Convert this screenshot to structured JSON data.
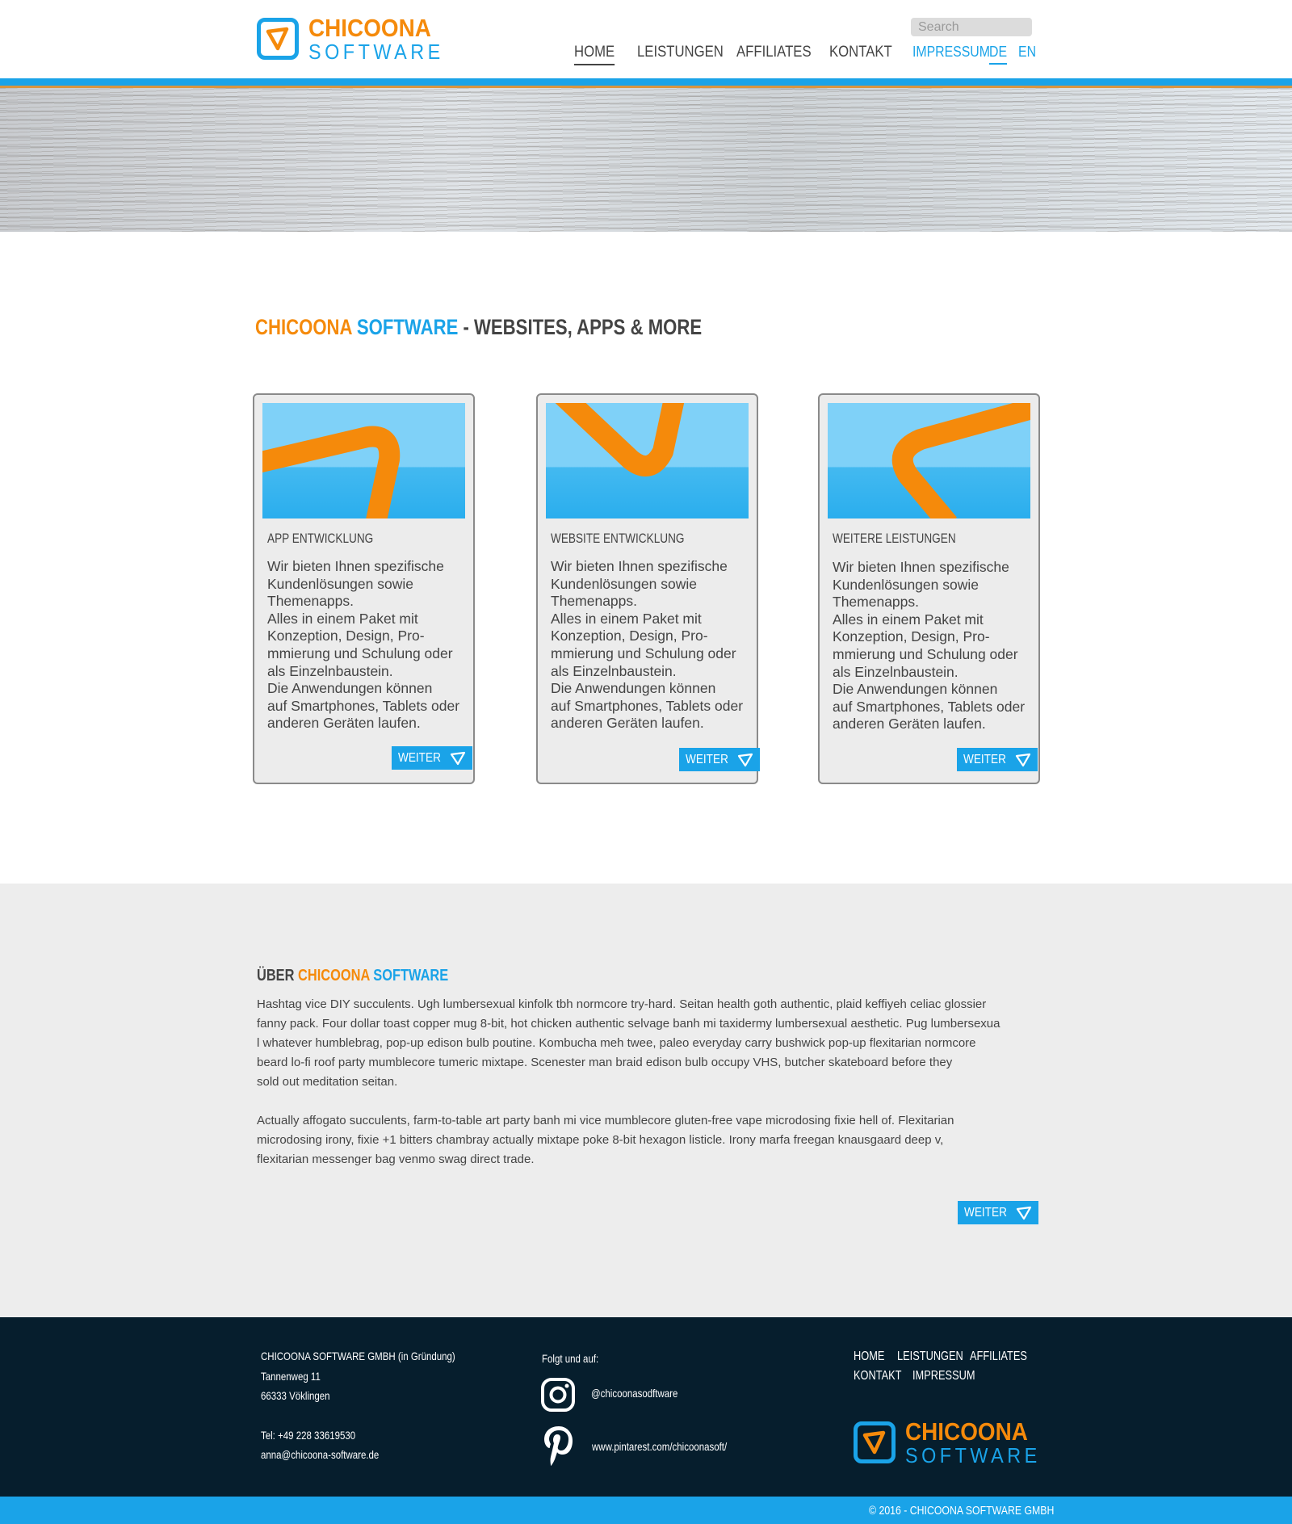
{
  "header": {
    "logo_line1": "CHICOONA",
    "logo_line2": "SOFTWARE",
    "search_placeholder": "Search",
    "nav": [
      "HOME",
      "LEISTUNGEN",
      "AFFILIATES",
      "KONTAKT"
    ],
    "secondary_nav": [
      "IMPRESSUM",
      "DE",
      "EN"
    ],
    "active_nav": "HOME",
    "active_lang": "DE"
  },
  "intro": {
    "title_orange": "CHICOONA",
    "title_blue": "SOFTWARE",
    "title_rest": " - WEBSITES, APPS & MORE"
  },
  "cards": [
    {
      "title": "APP ENTWICKLUNG",
      "lines": [
        "Wir bieten Ihnen spezifische",
        "Kundenlösungen sowie",
        "Themenapps.",
        "Alles in einem Paket mit",
        "Konzeption, Design, Pro-",
        "mmierung und Schulung oder",
        "als Einzelnbaustein.",
        "Die Anwendungen können",
        "auf Smartphones, Tablets oder",
        "anderen Geräten laufen."
      ],
      "button": "WEITER"
    },
    {
      "title": "WEBSITE ENTWICKLUNG",
      "lines": [
        "Wir bieten Ihnen spezifische",
        "Kundenlösungen sowie",
        "Themenapps.",
        "Alles in einem Paket mit",
        "Konzeption, Design, Pro-",
        "mmierung und Schulung oder",
        "als Einzelnbaustein.",
        "Die Anwendungen können",
        "auf Smartphones, Tablets oder",
        "anderen Geräten laufen."
      ],
      "button": "WEITER"
    },
    {
      "title": "WEITERE LEISTUNGEN",
      "lines": [
        "Wir bieten Ihnen spezifische",
        "Kundenlösungen sowie",
        "Themenapps.",
        "Alles in einem Paket mit",
        "Konzeption, Design, Pro-",
        "mmierung und Schulung oder",
        "als Einzelnbaustein.",
        "Die Anwendungen können",
        "auf Smartphones, Tablets oder",
        "anderen Geräten laufen."
      ],
      "button": "WEITER"
    }
  ],
  "about": {
    "title_prefix": "ÜBER ",
    "title_orange": "CHICOONA",
    "title_blue": " SOFTWARE",
    "paragraph1": [
      "Hashtag vice DIY succulents. Ugh lumbersexual kinfolk tbh normcore try-hard. Seitan health goth authentic, plaid keffiyeh celiac glossier",
      " fanny pack. Four dollar toast copper mug 8-bit, hot chicken authentic selvage banh mi taxidermy lumbersexual aesthetic. Pug lumbersexua",
      "l whatever humblebrag, pop-up edison bulb poutine. Kombucha meh twee, paleo everyday carry bushwick pop-up flexitarian normcore",
      " beard lo-fi roof party mumblecore tumeric mixtape. Scenester man braid edison bulb occupy VHS, butcher skateboard before they",
      " sold out meditation seitan."
    ],
    "paragraph2": [
      "Actually affogato succulents, farm-to-table art party banh mi vice mumblecore gluten-free vape microdosing fixie hell of. Flexitarian",
      "microdosing irony, fixie +1 bitters chambray actually mixtape poke 8-bit hexagon listicle. Irony marfa freegan knausgaard deep v,",
      "flexitarian messenger bag venmo swag direct trade."
    ],
    "button": "WEITER"
  },
  "footer": {
    "company": "CHICOONA SOFTWARE GMBH (in Gründung)",
    "street": "Tannenweg 11",
    "city": "66333 Vöklingen",
    "phone": "Tel: +49 228 33619530",
    "email": "anna@chicoona-software.de",
    "follow_label": "Folgt und auf:",
    "instagram": "@chicoonasodftware",
    "pinterest": "www.pintarest.com/chicoonasoft/",
    "nav_row1": [
      "HOME",
      "LEISTUNGEN",
      "AFFILIATES"
    ],
    "nav_row2": [
      "KONTAKT",
      "IMPRESSUM"
    ],
    "logo_line1": "CHICOONA",
    "logo_line2": "SOFTWARE",
    "copyright": "© 2016 - CHICOONA SOFTWARE GMBH"
  },
  "colors": {
    "accent_blue": "#1aa3e8",
    "accent_orange": "#f58a0b",
    "footer_bg": "#061e2d",
    "about_bg": "#ededed"
  }
}
